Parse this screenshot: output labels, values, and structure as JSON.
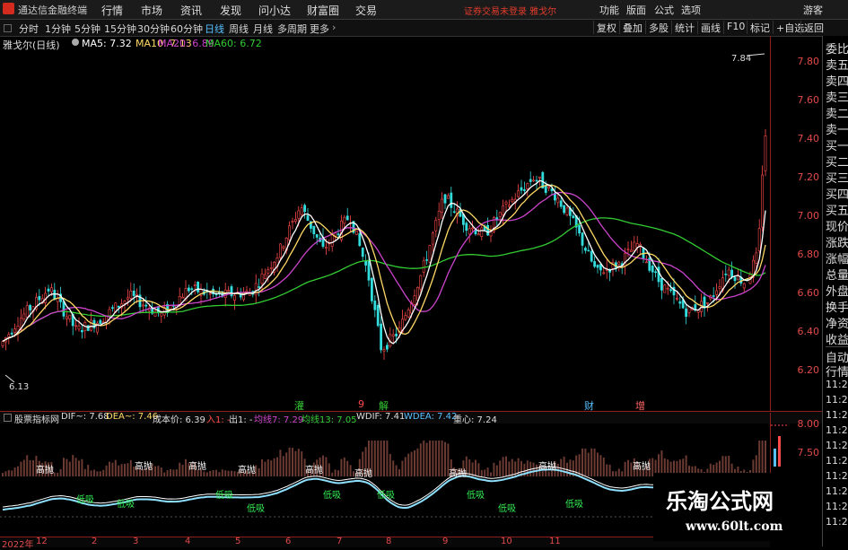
{
  "app": {
    "title": "通达信金融终端"
  },
  "menu": [
    "行情",
    "市场",
    "资讯",
    "发现",
    "问小达",
    "财富圈",
    "交易"
  ],
  "warning": "证券交易未登录  雅戈尔",
  "right_menu": [
    "功能",
    "版面",
    "公式",
    "选项",
    "游客"
  ],
  "periods": [
    "分时",
    "1分钟",
    "5分钟",
    "15分钟",
    "30分钟",
    "60分钟",
    "日线",
    "周线",
    "月线",
    "多周期",
    "更多"
  ],
  "toolbar": [
    "复权",
    "叠加",
    "多股",
    "统计",
    "画线",
    "F10",
    "标记",
    "+自选",
    "返回"
  ],
  "chart": {
    "label": "雅戈尔(日线)",
    "ma5": "MA5: 7.32",
    "ma10": "MA10: 7.13",
    "ma20": "MA20: 6.89",
    "ma60": "MA60: 6.72",
    "high_label": "7.84",
    "low_label": "6.13",
    "colors": {
      "ma5": "#ffffff",
      "ma10": "#ffd966",
      "ma20": "#cc44cc",
      "ma60": "#33cc33",
      "up": "#ff4a4a",
      "down": "#33dddd"
    }
  },
  "yaxis": [
    "7.80",
    "7.60",
    "7.40",
    "7.20",
    "7.00",
    "6.80",
    "6.60",
    "6.40",
    "6.20"
  ],
  "right_panel": [
    "委比",
    "卖五",
    "卖四",
    "卖三",
    "卖二",
    "卖一",
    "买一",
    "买二",
    "买三",
    "买四",
    "买五",
    "现价",
    "涨跌",
    "涨幅",
    "总量",
    "外盘",
    "换手",
    "净资",
    "收益",
    "自动",
    "行情",
    "11:29",
    "11:29",
    "11:29",
    "11:29",
    "11:29",
    "11:29",
    "11:29",
    "11:29",
    "11:29",
    "11:29"
  ],
  "events": [
    "灌",
    "9",
    "解",
    "财",
    "增"
  ],
  "indicator": {
    "name": "股票指标网",
    "dif": "DIF~: 7.68",
    "dea": "DEA~: 7.46",
    "cost": "成本价: 6.39",
    "in": "入1: -",
    "out": "出1: -",
    "avg7": "均线7: 7.29",
    "avg13": "均线13: 7.05",
    "wdif": "WDIF: 7.41",
    "wdea": "WDEA: 7.42",
    "center": "重心: 7.24",
    "yticks": [
      "8.00",
      "7.50"
    ]
  },
  "signals": {
    "high": "高抛",
    "low": "低吸"
  },
  "dates": [
    "2022年",
    "12",
    "2",
    "3",
    "4",
    "5",
    "6",
    "7",
    "8",
    "9",
    "10",
    "11"
  ],
  "watermark": {
    "title": "乐淘公式网",
    "url": "www.60lt.com"
  }
}
